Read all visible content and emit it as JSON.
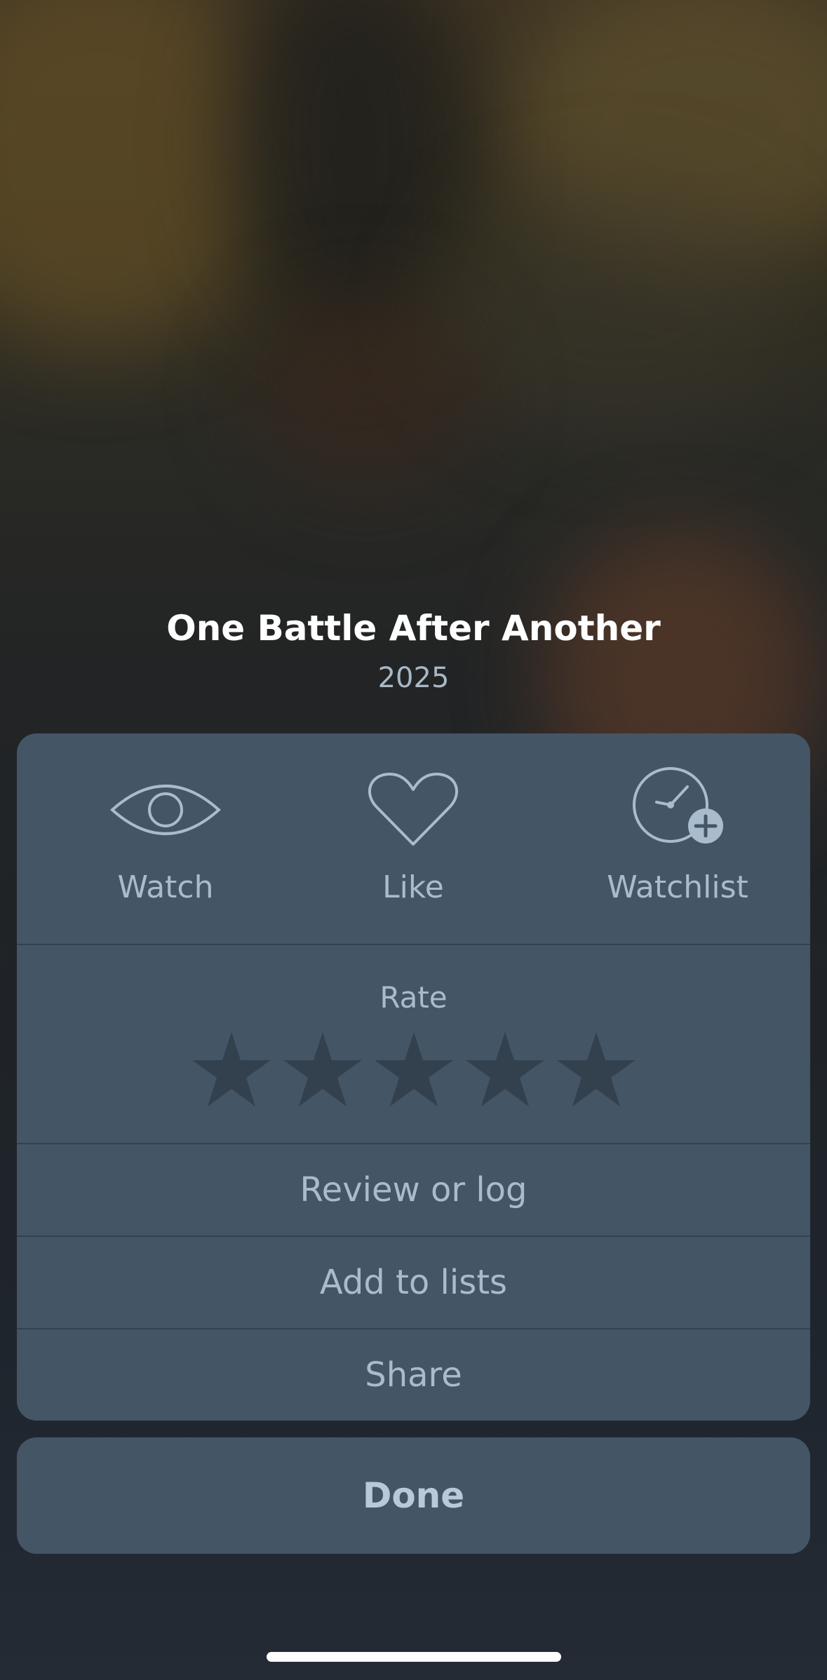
{
  "movie": {
    "title": "One Battle After Another",
    "year": "2025"
  },
  "actions": [
    {
      "label": "Watch",
      "icon": "eye-icon"
    },
    {
      "label": "Like",
      "icon": "heart-icon"
    },
    {
      "label": "Watchlist",
      "icon": "clock-plus-icon"
    }
  ],
  "rating": {
    "label": "Rate",
    "value": 0,
    "max": 5
  },
  "menu": {
    "review_label": "Review or log",
    "add_to_lists_label": "Add to lists",
    "share_label": "Share"
  },
  "done_label": "Done",
  "colors": {
    "sheet": "#445566",
    "label": "#a9bccd",
    "star_empty": "#33414f",
    "divider": "#33414f"
  }
}
